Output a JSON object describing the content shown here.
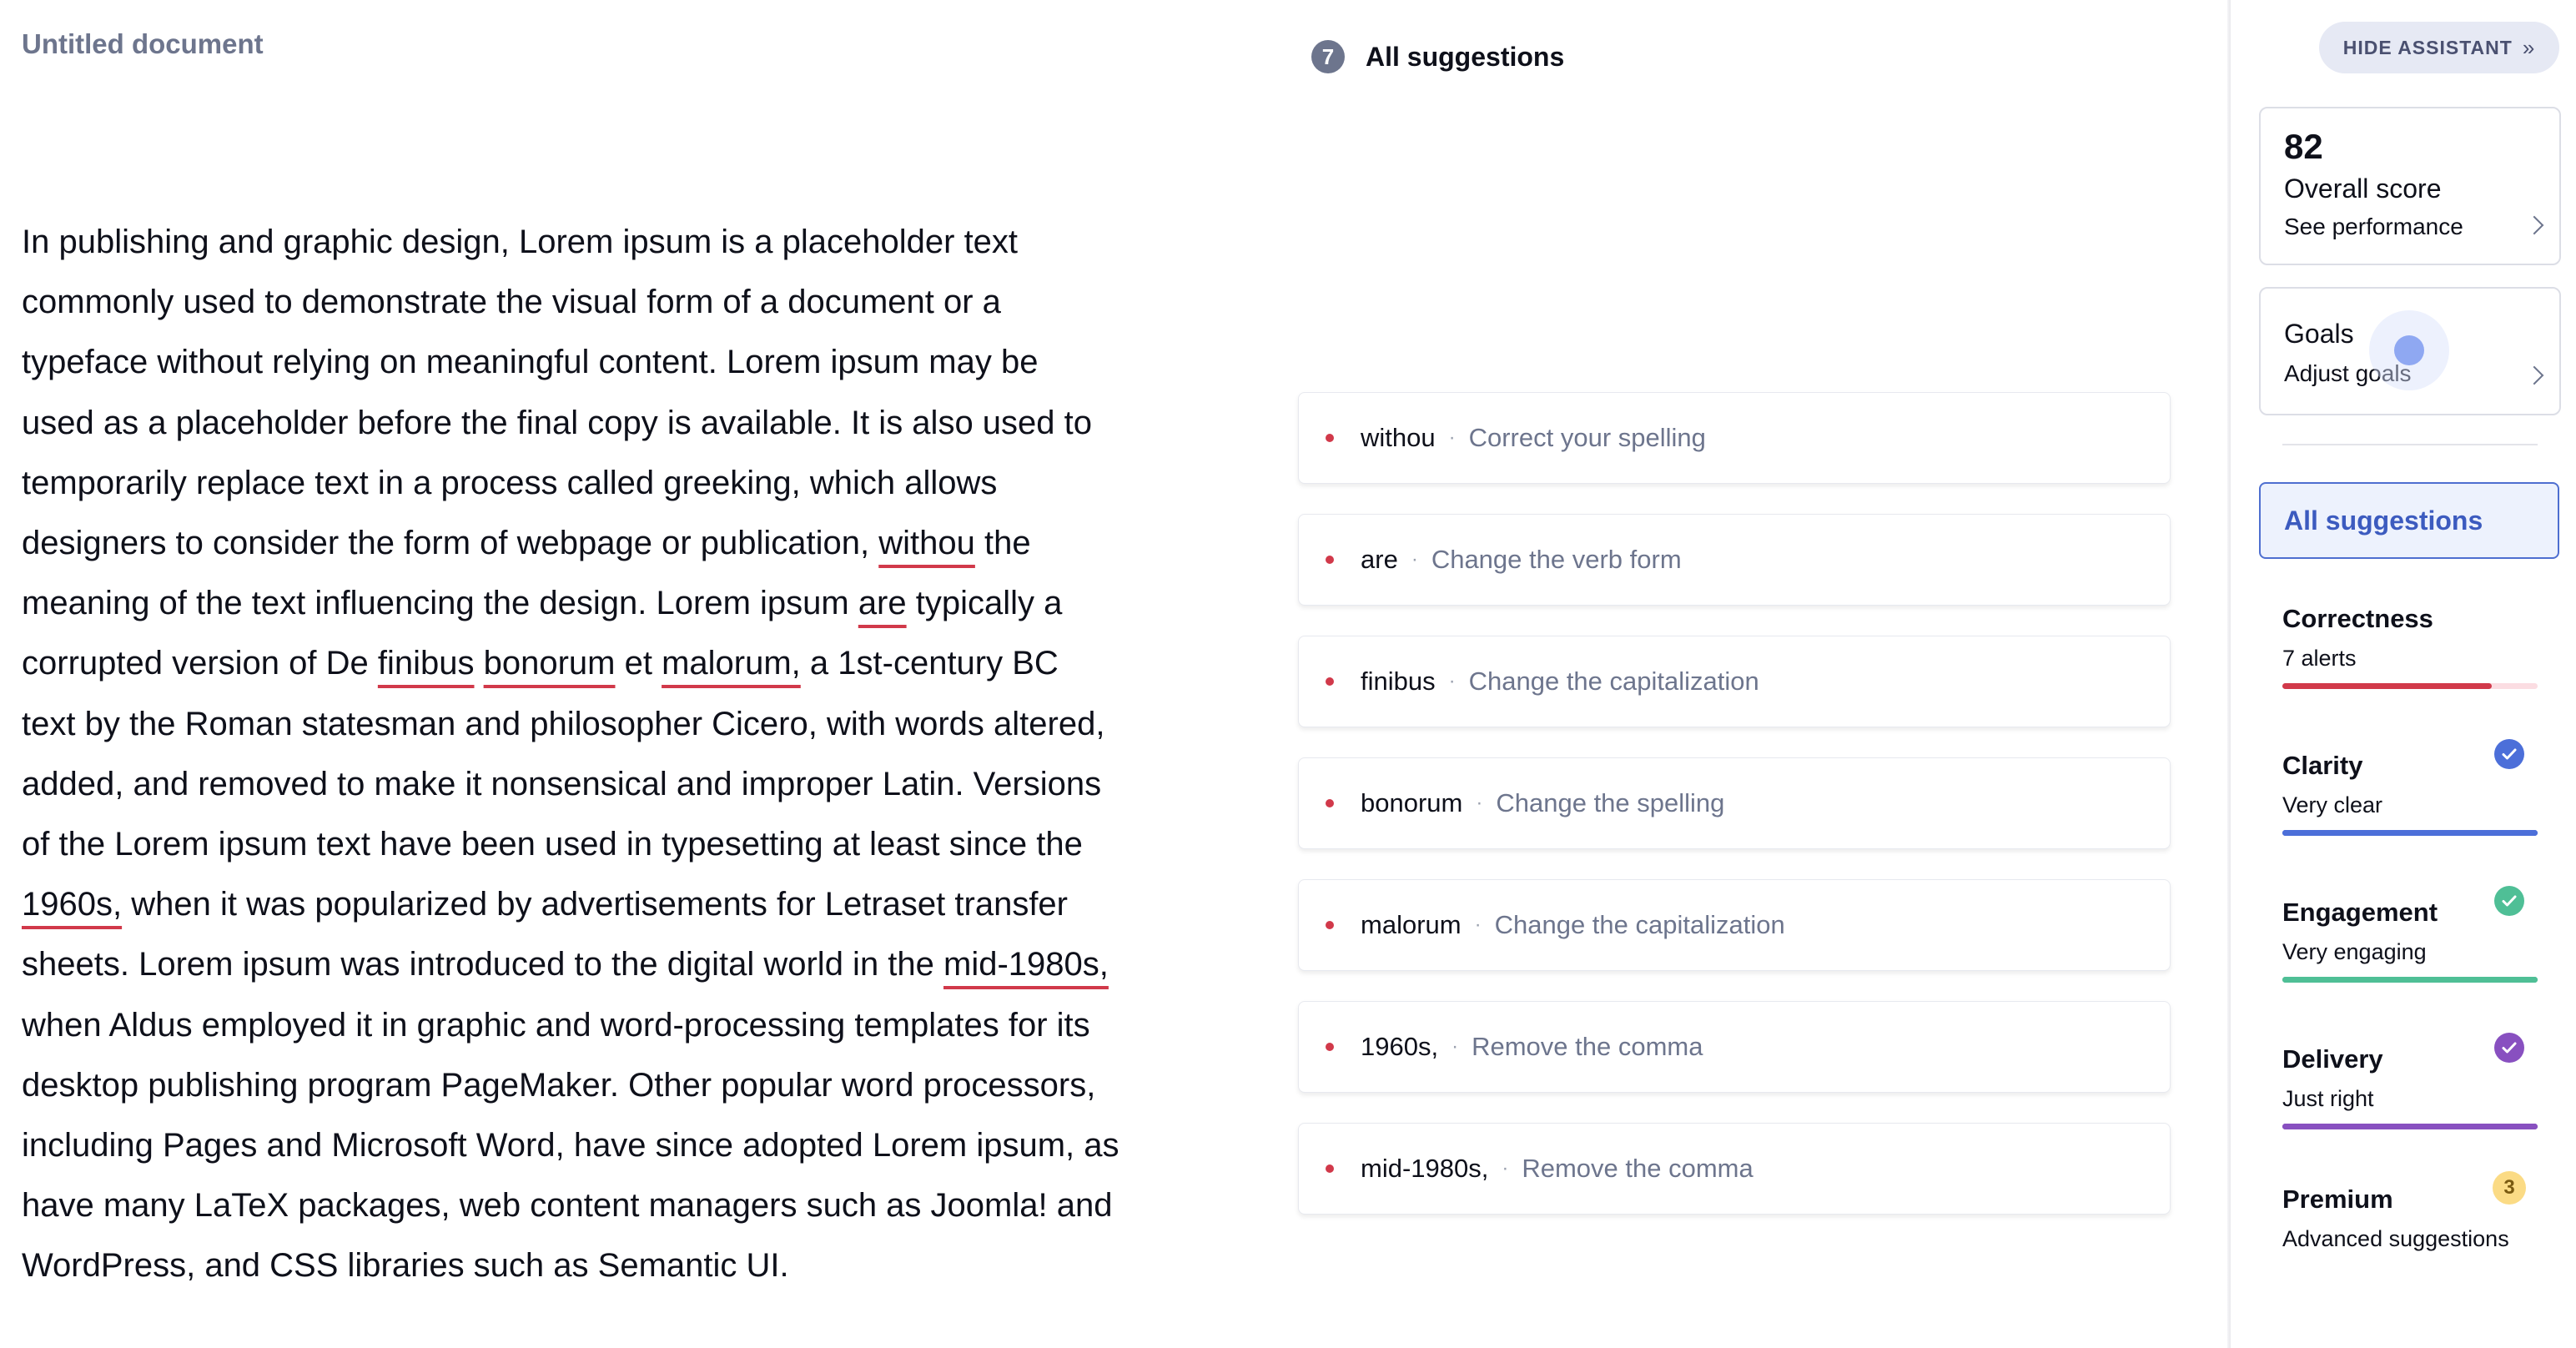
{
  "document": {
    "title": "Untitled document",
    "lines": [
      [
        {
          "t": "In publishing and graphic design, Lorem ipsum is a placeholder text"
        }
      ],
      [
        {
          "t": "commonly used to demonstrate the visual form of a document or a"
        }
      ],
      [
        {
          "t": "typeface without relying on meaningful content. Lorem ipsum may be"
        }
      ],
      [
        {
          "t": "used as a placeholder before the final copy is available. It is also used to"
        }
      ],
      [
        {
          "t": "temporarily replace text in a process called greeking, which allows"
        }
      ],
      [
        {
          "t": "designers to consider the form of webpage or publication, "
        },
        {
          "t": "withou",
          "err": true
        },
        {
          "t": " the"
        }
      ],
      [
        {
          "t": "meaning of the text influencing the design. Lorem ipsum "
        },
        {
          "t": "are",
          "err": true
        },
        {
          "t": " typically a"
        }
      ],
      [
        {
          "t": "corrupted version of De "
        },
        {
          "t": "finibus",
          "err": true
        },
        {
          "t": " "
        },
        {
          "t": "bonorum",
          "err": true
        },
        {
          "t": " et "
        },
        {
          "t": "malorum,",
          "err": true
        },
        {
          "t": " a 1st-century BC"
        }
      ],
      [
        {
          "t": "text by the Roman statesman and philosopher Cicero, with words altered,"
        }
      ],
      [
        {
          "t": "added, and removed to make it nonsensical and improper Latin. Versions"
        }
      ],
      [
        {
          "t": "of the Lorem ipsum text have been used in typesetting at least since the"
        }
      ],
      [
        {
          "t": "1960s,",
          "err": true
        },
        {
          "t": " when it was popularized by advertisements for Letraset transfer"
        }
      ],
      [
        {
          "t": "sheets. Lorem ipsum was introduced to the digital world in the "
        },
        {
          "t": "mid-1980s,",
          "err": true
        }
      ],
      [
        {
          "t": "when Aldus employed it in graphic and word-processing templates for its"
        }
      ],
      [
        {
          "t": "desktop publishing program PageMaker. Other popular word processors,"
        }
      ],
      [
        {
          "t": "including Pages and Microsoft Word, have since adopted Lorem ipsum, as"
        }
      ],
      [
        {
          "t": "have many LaTeX packages, web content managers such as Joomla! and"
        }
      ],
      [
        {
          "t": "WordPress, and CSS libraries such as Semantic UI."
        }
      ]
    ]
  },
  "suggestions_panel": {
    "count": "7",
    "title": "All suggestions",
    "separator": "·",
    "items": [
      {
        "word": "withou",
        "description": "Correct your spelling"
      },
      {
        "word": "are",
        "description": "Change the verb form"
      },
      {
        "word": "finibus",
        "description": "Change the capitalization"
      },
      {
        "word": "bonorum",
        "description": "Change the spelling"
      },
      {
        "word": "malorum",
        "description": "Change the capitalization"
      },
      {
        "word": "1960s,",
        "description": "Remove the comma"
      },
      {
        "word": "mid-1980s,",
        "description": "Remove the comma"
      }
    ]
  },
  "assistant": {
    "hide_label": "HIDE ASSISTANT",
    "hide_icon": "»",
    "score": {
      "value": "82",
      "label": "Overall score",
      "link": "See performance"
    },
    "goals": {
      "label": "Goals",
      "link": "Adjust goals"
    },
    "all_suggestions_label": "All suggestions",
    "categories": [
      {
        "name": "Correctness",
        "status": "7 alerts",
        "color": "#d1394a",
        "track": "#fbdde2",
        "progress": 0.82,
        "icon": "none"
      },
      {
        "name": "Clarity",
        "status": "Very clear",
        "color": "#4c6fd9",
        "track": "#4c6fd9",
        "progress": 1.0,
        "icon": "check-circle-icon"
      },
      {
        "name": "Engagement",
        "status": "Very engaging",
        "color": "#4fbf96",
        "track": "#4fbf96",
        "progress": 1.0,
        "icon": "check-circle-icon"
      },
      {
        "name": "Delivery",
        "status": "Just right",
        "color": "#8850c0",
        "track": "#8850c0",
        "progress": 1.0,
        "icon": "check-circle-icon"
      }
    ],
    "premium": {
      "name": "Premium",
      "status": "Advanced suggestions",
      "badge": "3",
      "badge_color": "#fbdb85"
    }
  },
  "colors": {
    "error": "#d1394a",
    "accent": "#4e6fd0"
  }
}
